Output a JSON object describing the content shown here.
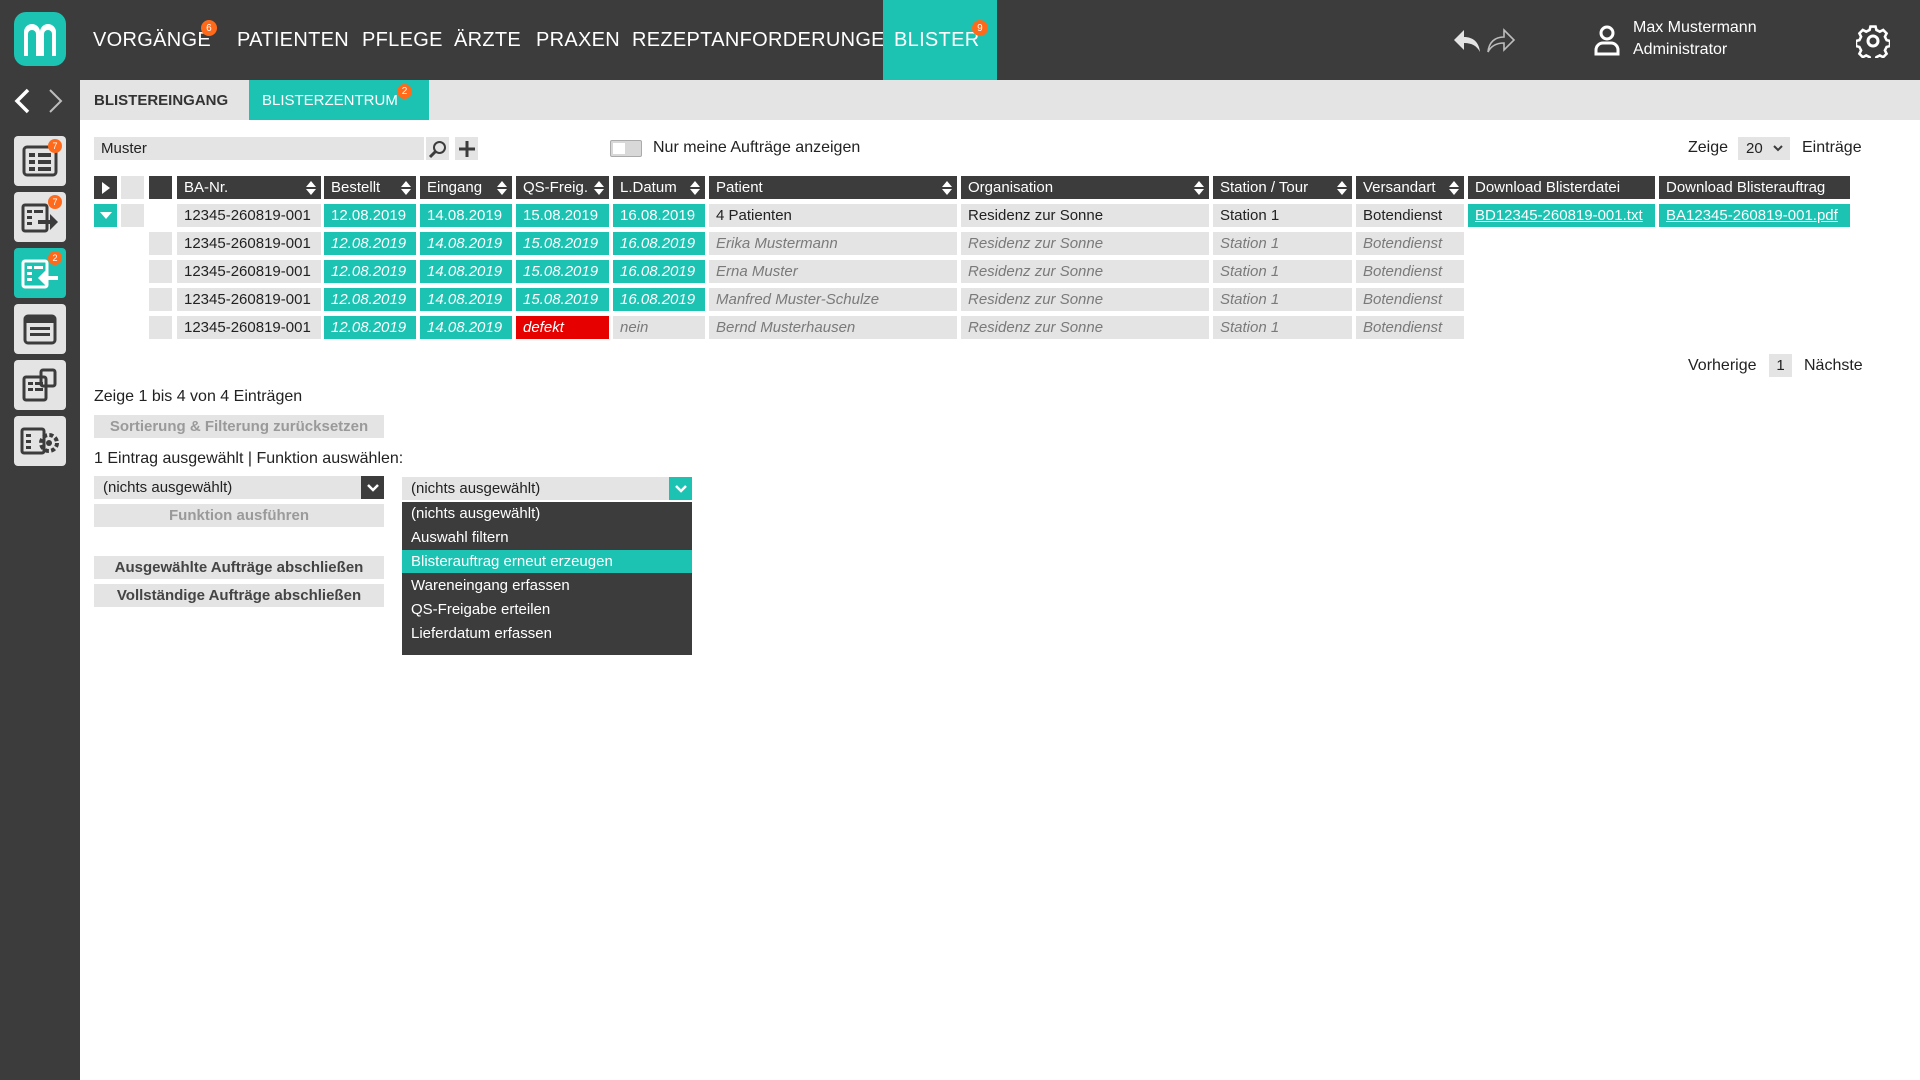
{
  "nav": {
    "items": [
      {
        "label": "VORGÄNGE",
        "badge": "6"
      },
      {
        "label": "PATIENTEN"
      },
      {
        "label": "PFLEGE"
      },
      {
        "label": "ÄRZTE"
      },
      {
        "label": "PRAXEN"
      },
      {
        "label": "REZEPTANFORDERUNGEN"
      },
      {
        "label": "BLISTER",
        "badge": "9",
        "active": true
      }
    ]
  },
  "user": {
    "name": "Max Mustermann",
    "role": "Administrator"
  },
  "sidebar": {
    "badges": [
      "7",
      "7",
      "2"
    ]
  },
  "subtabs": [
    {
      "label": "BLISTEREINGANG"
    },
    {
      "label": "BLISTERZENTRUM",
      "badge": "2",
      "active": true
    }
  ],
  "toolbar": {
    "search_value": "Muster",
    "toggle_label": "Nur meine Aufträge anzeigen",
    "show_label": "Zeige",
    "page_size": "20",
    "entries_label": "Einträge"
  },
  "table": {
    "headers": [
      "BA-Nr.",
      "Bestellt",
      "Eingang",
      "QS-Freig.",
      "L.Datum",
      "Patient",
      "Organisation",
      "Station / Tour",
      "Versandart",
      "Download Blisterdatei",
      "Download Blisterauftrag"
    ],
    "rows": [
      {
        "ba": "12345-260819-001",
        "bestellt": "12.08.2019",
        "eingang": "14.08.2019",
        "qs": "15.08.2019",
        "ldatum": "16.08.2019",
        "patient": "4 Patienten",
        "org": "Residenz zur Sonne",
        "station": "Station 1",
        "versand": "Botendienst",
        "dl_datei": "BD12345-260819-001.txt",
        "dl_auftrag": "BA12345-260819-001.pdf"
      },
      {
        "ba": "12345-260819-001",
        "bestellt": "12.08.2019",
        "eingang": "14.08.2019",
        "qs": "15.08.2019",
        "ldatum": "16.08.2019",
        "patient": "Erika Mustermann",
        "org": "Residenz zur Sonne",
        "station": "Station 1",
        "versand": "Botendienst"
      },
      {
        "ba": "12345-260819-001",
        "bestellt": "12.08.2019",
        "eingang": "14.08.2019",
        "qs": "15.08.2019",
        "ldatum": "16.08.2019",
        "patient": "Erna Muster",
        "org": "Residenz zur Sonne",
        "station": "Station 1",
        "versand": "Botendienst"
      },
      {
        "ba": "12345-260819-001",
        "bestellt": "12.08.2019",
        "eingang": "14.08.2019",
        "qs": "15.08.2019",
        "ldatum": "16.08.2019",
        "patient": "Manfred Muster-Schulze",
        "org": "Residenz zur Sonne",
        "station": "Station 1",
        "versand": "Botendienst"
      },
      {
        "ba": "12345-260819-001",
        "bestellt": "12.08.2019",
        "eingang": "14.08.2019",
        "qs": "defekt",
        "ldatum": "nein",
        "patient": "Bernd Musterhausen",
        "org": "Residenz zur Sonne",
        "station": "Station 1",
        "versand": "Botendienst"
      }
    ]
  },
  "pagination": {
    "prev": "Vorherige",
    "page": "1",
    "next": "Nächste"
  },
  "info_text": "Zeige 1 bis 4 von 4 Einträgen",
  "reset_button": "Sortierung & Filterung zurücksetzen",
  "selection_label": "1 Eintrag ausgewählt | Funktion auswählen:",
  "function_select": {
    "value": "(nichts ausgewählt)"
  },
  "execute_button": "Funktion ausführen",
  "close_selected_button": "Ausgewählte Aufträge abschließen",
  "close_complete_button": "Vollständige Aufträge abschließen",
  "action_select": {
    "value": "(nichts ausgewählt)",
    "options": [
      "(nichts ausgewählt)",
      "Auswahl filtern",
      "Blisterauftrag erneut erzeugen",
      "Wareneingang erfassen",
      "QS-Freigabe erteilen",
      "Lieferdatum erfassen"
    ],
    "highlighted": "Blisterauftrag erneut erzeugen"
  },
  "colors": {
    "accent": "#1cc3b2",
    "dark": "#3c3c3c",
    "badge": "#ff6a1a",
    "error": "#e60000",
    "light": "#e4e4e4"
  }
}
